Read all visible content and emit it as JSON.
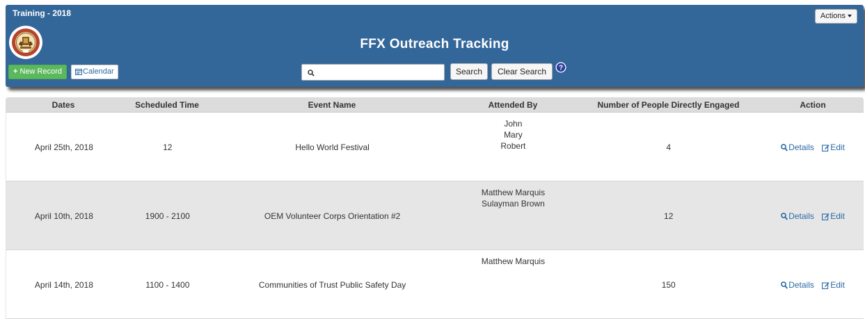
{
  "header": {
    "env_label": "Training - 2018",
    "title": "FFX Outreach Tracking",
    "actions_label": "Actions",
    "new_record_label": "New Record",
    "calendar_label": "Calendar",
    "search_placeholder": "",
    "search_label": "Search",
    "clear_search_label": "Clear Search"
  },
  "table": {
    "columns": [
      "Dates",
      "Scheduled Time",
      "Event Name",
      "Attended By",
      "Number of People Directly Engaged",
      "Action"
    ],
    "rows": [
      {
        "date": "April 25th, 2018",
        "time": "12",
        "event": "Hello World Festival",
        "attended": [
          "John",
          "Mary",
          "Robert"
        ],
        "engaged": "4"
      },
      {
        "date": "April 10th, 2018",
        "time": "1900 - 2100",
        "event": "OEM Volunteer Corps Orientation #2",
        "attended": [
          "Matthew Marquis",
          "Sulayman Brown"
        ],
        "engaged": "12"
      },
      {
        "date": "April 14th, 2018",
        "time": "1100 - 1400",
        "event": "Communities of Trust Public Safety Day",
        "attended": [
          "Matthew Marquis"
        ],
        "engaged": "150"
      }
    ],
    "details_label": "Details",
    "edit_label": "Edit"
  },
  "colors": {
    "header_bg": "#336699",
    "new_button": "#5cb85c",
    "link": "#2a6aa5"
  }
}
